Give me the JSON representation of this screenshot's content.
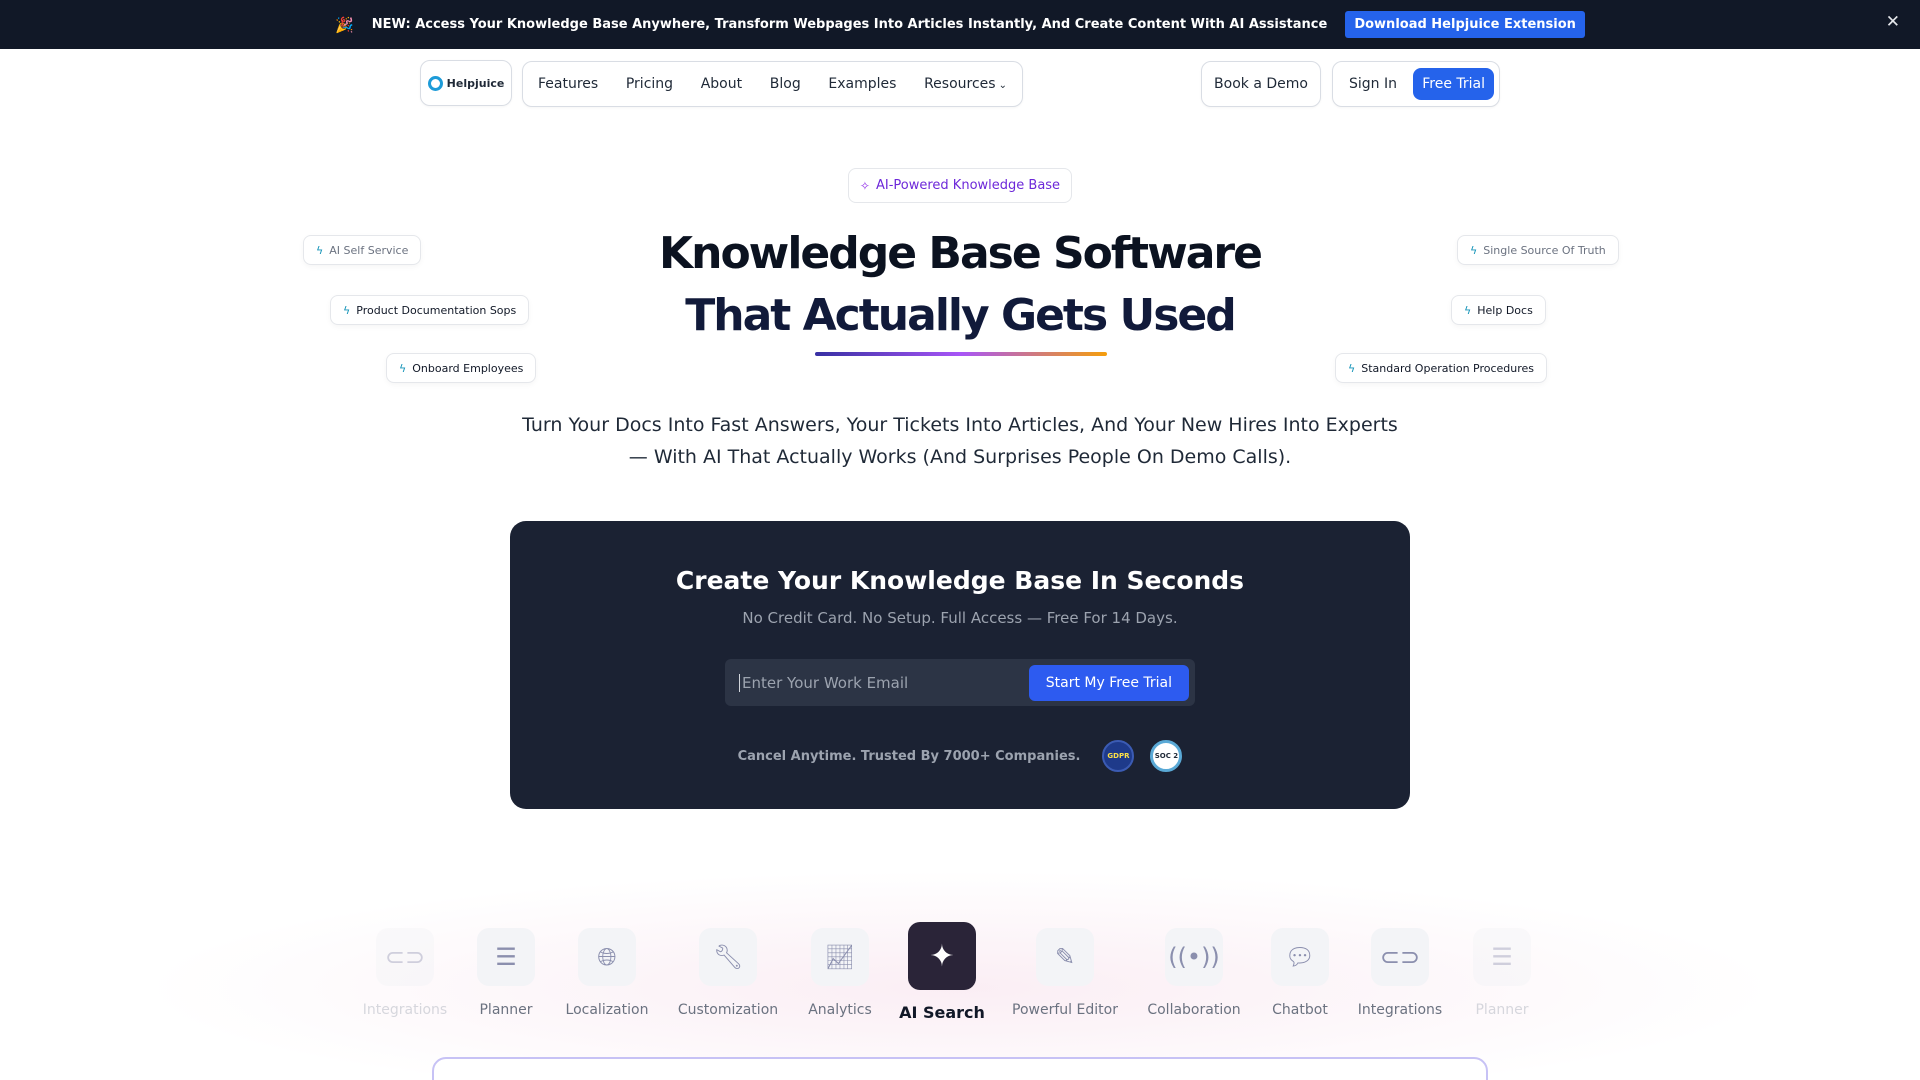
{
  "announcement": {
    "emoji": "🎉",
    "message": "NEW: Access Your Knowledge Base Anywhere, Transform Webpages Into Articles Instantly, And Create Content With AI Assistance",
    "button": "Download Helpjuice Extension",
    "close": "✕"
  },
  "nav": {
    "logo": "Helpjuice",
    "links": [
      "Features",
      "Pricing",
      "About",
      "Blog",
      "Examples",
      "Resources"
    ],
    "resources_chevron": "⌄",
    "book_demo": "Book a Demo",
    "sign_in": "Sign In",
    "free_trial": "Free Trial"
  },
  "hero": {
    "badge": "AI-Powered Knowledge Base",
    "badge_icon": "sparkle-icon",
    "title_line1": "Knowledge Base Software",
    "title_line2": "That Actually Gets Used",
    "subtitle": "Turn Your Docs Into Fast Answers, Your Tickets Into Articles, And Your New Hires Into Experts — With AI That Actually Works (And Surprises People On Demo Calls).",
    "chips_left": [
      "AI Self Service",
      "Product Documentation Sops",
      "Onboard Employees"
    ],
    "chips_right": [
      "Single Source Of Truth",
      "Help Docs",
      "Standard Operation Procedures"
    ]
  },
  "cta": {
    "heading": "Create Your Knowledge Base In Seconds",
    "note": "No Credit Card. No Setup. Full Access — Free For 14 Days.",
    "email_placeholder": "Enter Your Work Email",
    "email_value": "",
    "button": "Start My Free Trial",
    "trust_text": "Cancel Anytime. Trusted By 7000+ Companies.",
    "seals": [
      "GDPR",
      "SOC 2"
    ]
  },
  "features": {
    "active": "AI Search",
    "items": [
      {
        "label": "Integrations",
        "icon": "toggle-icon",
        "glyph": "⊂⊃"
      },
      {
        "label": "Planner",
        "icon": "planner-icon",
        "glyph": "☰"
      },
      {
        "label": "Localization",
        "icon": "globe-icon",
        "glyph": "🌐︎"
      },
      {
        "label": "Customization",
        "icon": "wrench-icon",
        "glyph": "🔧︎"
      },
      {
        "label": "Analytics",
        "icon": "chart-icon",
        "glyph": "📈︎"
      },
      {
        "label": "AI Search",
        "icon": "sparkle-icon",
        "glyph": "✦"
      },
      {
        "label": "Powerful Editor",
        "icon": "pen-icon",
        "glyph": "✎"
      },
      {
        "label": "Collaboration",
        "icon": "broadcast-icon",
        "glyph": "((•))"
      },
      {
        "label": "Chatbot",
        "icon": "chat-bubble-icon",
        "glyph": "💬︎"
      },
      {
        "label": "Integrations",
        "icon": "toggle-icon",
        "glyph": "⊂⊃"
      },
      {
        "label": "Planner",
        "icon": "planner-icon",
        "glyph": "☰"
      }
    ]
  },
  "colors": {
    "announcement_bg": "#111827",
    "accent": "#2563eb",
    "cta_bg": "#1b2233",
    "badge_text": "#6d28d9",
    "chip_icon": "#1493b8"
  }
}
